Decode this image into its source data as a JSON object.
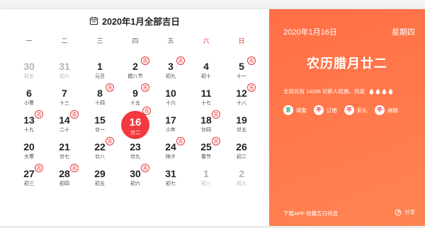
{
  "header": {
    "title": "2020年1月全部吉日"
  },
  "weekdays": [
    {
      "label": "一",
      "weekend": false
    },
    {
      "label": "二",
      "weekend": false
    },
    {
      "label": "三",
      "weekend": false
    },
    {
      "label": "四",
      "weekend": false
    },
    {
      "label": "五",
      "weekend": false
    },
    {
      "label": "六",
      "weekend": true
    },
    {
      "label": "日",
      "weekend": true
    }
  ],
  "days": [
    {
      "num": "30",
      "lunar": "初五",
      "other": true,
      "ji": false
    },
    {
      "num": "31",
      "lunar": "初六",
      "other": true,
      "ji": false
    },
    {
      "num": "1",
      "lunar": "元旦",
      "ji": false
    },
    {
      "num": "2",
      "lunar": "腊八节",
      "ji": true
    },
    {
      "num": "3",
      "lunar": "初九",
      "ji": true
    },
    {
      "num": "4",
      "lunar": "初十",
      "ji": false
    },
    {
      "num": "5",
      "lunar": "十一",
      "ji": true
    },
    {
      "num": "6",
      "lunar": "小寒",
      "ji": false
    },
    {
      "num": "7",
      "lunar": "十三",
      "ji": false
    },
    {
      "num": "8",
      "lunar": "十四",
      "ji": true
    },
    {
      "num": "9",
      "lunar": "十五",
      "ji": true
    },
    {
      "num": "10",
      "lunar": "十六",
      "ji": false
    },
    {
      "num": "11",
      "lunar": "十七",
      "ji": false
    },
    {
      "num": "12",
      "lunar": "十八",
      "ji": true
    },
    {
      "num": "13",
      "lunar": "十九",
      "ji": true
    },
    {
      "num": "14",
      "lunar": "二十",
      "ji": true
    },
    {
      "num": "15",
      "lunar": "廿一",
      "ji": false
    },
    {
      "num": "16",
      "lunar": "廿二",
      "ji": true,
      "today": true
    },
    {
      "num": "17",
      "lunar": "小年",
      "ji": false
    },
    {
      "num": "18",
      "lunar": "廿四",
      "ji": true
    },
    {
      "num": "19",
      "lunar": "廿五",
      "ji": false
    },
    {
      "num": "20",
      "lunar": "大寒",
      "ji": false
    },
    {
      "num": "21",
      "lunar": "廿七",
      "ji": false
    },
    {
      "num": "22",
      "lunar": "廿八",
      "ji": true
    },
    {
      "num": "23",
      "lunar": "廿九",
      "ji": false
    },
    {
      "num": "24",
      "lunar": "除夕",
      "ji": true
    },
    {
      "num": "25",
      "lunar": "春节",
      "ji": true
    },
    {
      "num": "26",
      "lunar": "初二",
      "ji": false
    },
    {
      "num": "27",
      "lunar": "初三",
      "ji": true
    },
    {
      "num": "28",
      "lunar": "初四",
      "ji": true
    },
    {
      "num": "29",
      "lunar": "初五",
      "ji": false
    },
    {
      "num": "30",
      "lunar": "初六",
      "ji": true
    },
    {
      "num": "31",
      "lunar": "初七",
      "ji": false
    },
    {
      "num": "1",
      "lunar": "初八",
      "other": true,
      "ji": false
    },
    {
      "num": "2",
      "lunar": "初九",
      "other": true,
      "ji": false
    }
  ],
  "ji_label": "吉",
  "detail": {
    "date": "2020年1月16日",
    "weekday": "星期四",
    "lunar": "农历腊月廿二",
    "stat": "全国共有 14296 对新人结婚，热度",
    "heat_level": 4,
    "tags": [
      {
        "badge": "宜",
        "label": "嫁娶",
        "color": "#1aa06d"
      },
      {
        "badge": "平",
        "label": "订婚",
        "color": "#f2393f"
      },
      {
        "badge": "平",
        "label": "彩礼",
        "color": "#f2393f"
      },
      {
        "badge": "平",
        "label": "纳婿",
        "color": "#f2393f"
      }
    ],
    "app_text": "下载APP 收藏吉日待选",
    "share_text": "分享"
  }
}
